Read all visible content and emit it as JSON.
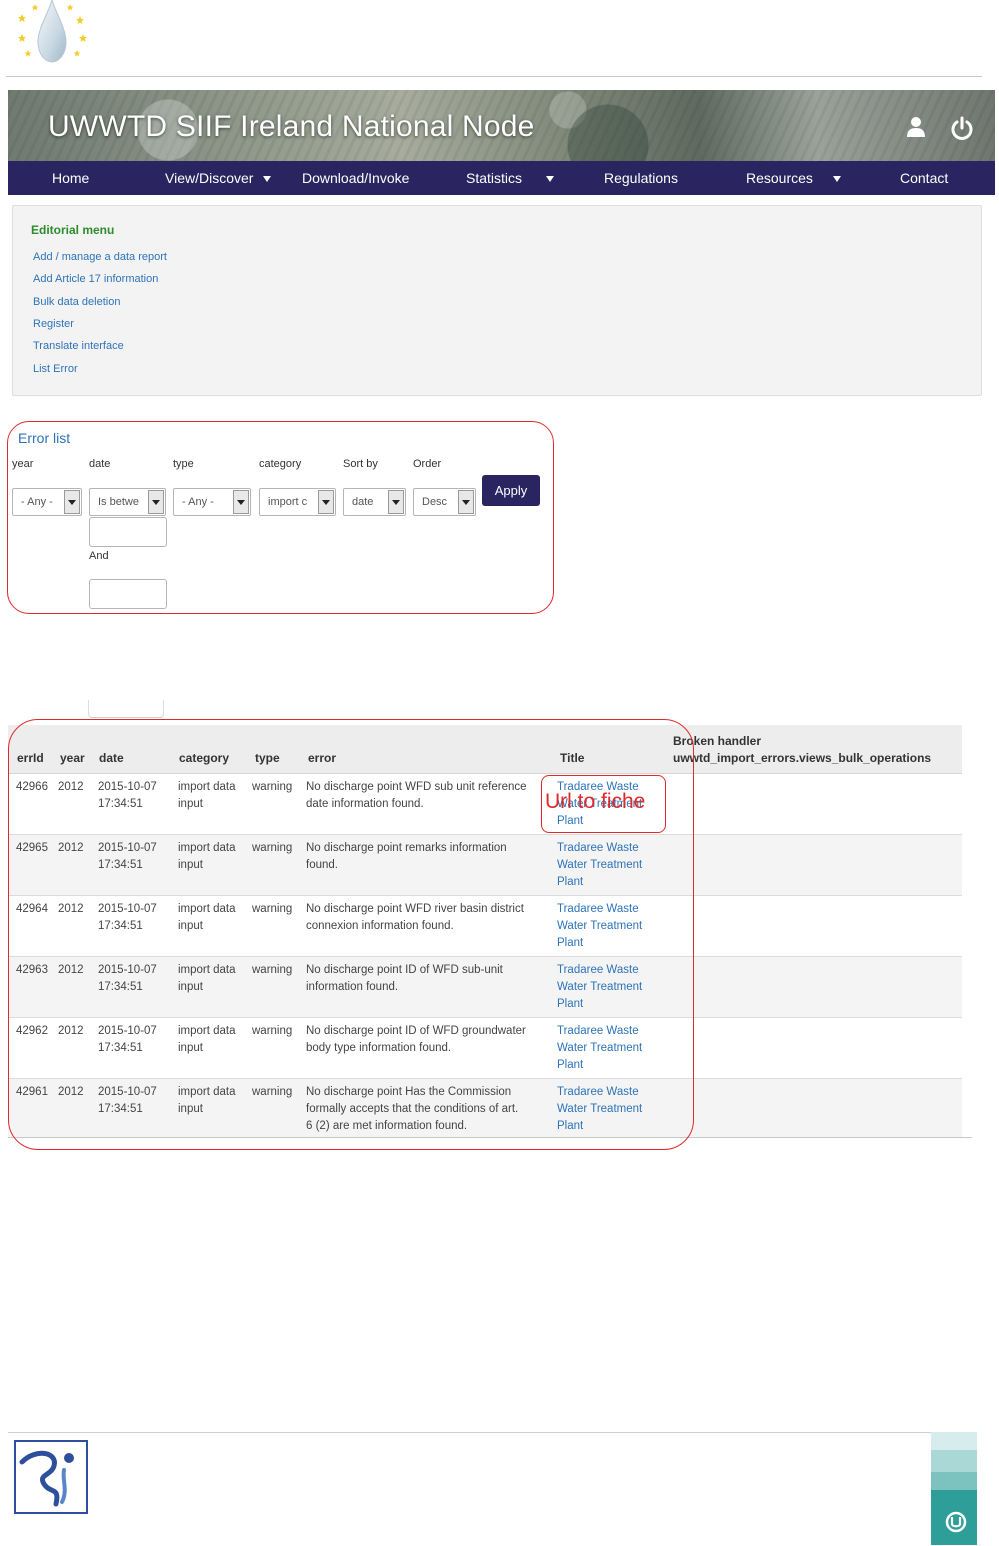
{
  "banner": {
    "title": "UWWTD SIIF Ireland National Node"
  },
  "icons": {
    "top_logo": "water-drop-eu-stars-logo",
    "user": "user-icon",
    "power": "power-icon",
    "footer_left": "organisation-logo",
    "footer_right": "u-logo"
  },
  "nav": [
    {
      "label": "Home",
      "dropdown": false
    },
    {
      "label": "View/Discover",
      "dropdown": true
    },
    {
      "label": "Download/Invoke",
      "dropdown": false
    },
    {
      "label": "Statistics",
      "dropdown": true
    },
    {
      "label": "Regulations",
      "dropdown": false
    },
    {
      "label": "Resources",
      "dropdown": true
    },
    {
      "label": "Contact",
      "dropdown": false
    }
  ],
  "editorial": {
    "title": "Editorial menu",
    "links": [
      "Add / manage a data report",
      "Add Article 17 information",
      "Bulk data deletion",
      "Register",
      "Translate interface",
      "List Error"
    ]
  },
  "filters": {
    "title": "Error list",
    "labels": {
      "year": "year",
      "date": "date",
      "type": "type",
      "category": "category",
      "sort_by": "Sort by",
      "order": "Order"
    },
    "values": {
      "year": "- Any -",
      "date": "Is betwe",
      "type": "- Any -",
      "category": "import c",
      "sort_by": "date",
      "order": "Desc"
    },
    "and_label": "And",
    "apply": "Apply"
  },
  "table": {
    "headers": {
      "errid": "errId",
      "year": "year",
      "date": "date",
      "category": "category",
      "type": "type",
      "error": "error",
      "title": "Title",
      "broken_1": "Broken handler",
      "broken_2": "uwwtd_import_errors.views_bulk_operations"
    },
    "rows": [
      {
        "errid": "42966",
        "year": "2012",
        "date1": "2015-10-07",
        "date2": "17:34:51",
        "cat1": "import data",
        "cat2": "input",
        "type": "warning",
        "err1": "No discharge point WFD sub unit reference",
        "err2": "date information found.",
        "err3": "",
        "t1": "Tradaree Waste",
        "t2": "Water Treatment",
        "t3": "Plant"
      },
      {
        "errid": "42965",
        "year": "2012",
        "date1": "2015-10-07",
        "date2": "17:34:51",
        "cat1": "import data",
        "cat2": "input",
        "type": "warning",
        "err1": "No discharge point remarks information",
        "err2": "found.",
        "err3": "",
        "t1": "Tradaree Waste",
        "t2": "Water Treatment",
        "t3": "Plant"
      },
      {
        "errid": "42964",
        "year": "2012",
        "date1": "2015-10-07",
        "date2": "17:34:51",
        "cat1": "import data",
        "cat2": "input",
        "type": "warning",
        "err1": "No discharge point WFD river basin district",
        "err2": "connexion information found.",
        "err3": "",
        "t1": "Tradaree Waste",
        "t2": "Water Treatment",
        "t3": "Plant"
      },
      {
        "errid": "42963",
        "year": "2012",
        "date1": "2015-10-07",
        "date2": "17:34:51",
        "cat1": "import data",
        "cat2": "input",
        "type": "warning",
        "err1": "No discharge point ID of WFD sub-unit",
        "err2": "information found.",
        "err3": "",
        "t1": "Tradaree Waste",
        "t2": "Water Treatment",
        "t3": "Plant"
      },
      {
        "errid": "42962",
        "year": "2012",
        "date1": "2015-10-07",
        "date2": "17:34:51",
        "cat1": "import data",
        "cat2": "input",
        "type": "warning",
        "err1": "No discharge point ID of WFD groundwater",
        "err2": "body type information found.",
        "err3": "",
        "t1": "Tradaree Waste",
        "t2": "Water Treatment",
        "t3": "Plant"
      },
      {
        "errid": "42961",
        "year": "2012",
        "date1": "2015-10-07",
        "date2": "17:34:51",
        "cat1": "import data",
        "cat2": "input",
        "type": "warning",
        "err1": "No discharge point Has the Commission",
        "err2": "formally accepts that the conditions of art.",
        "err3": "6 (2) are met information found.",
        "t1": "Tradaree Waste",
        "t2": "Water Treatment",
        "t3": "Plant"
      }
    ]
  },
  "annotation": {
    "label": "Url to fiche"
  },
  "colors": {
    "nav_bg": "#2a2460",
    "link": "#2e73b8",
    "editorial_title": "#2e8b2e",
    "highlight": "#e02a2a"
  }
}
